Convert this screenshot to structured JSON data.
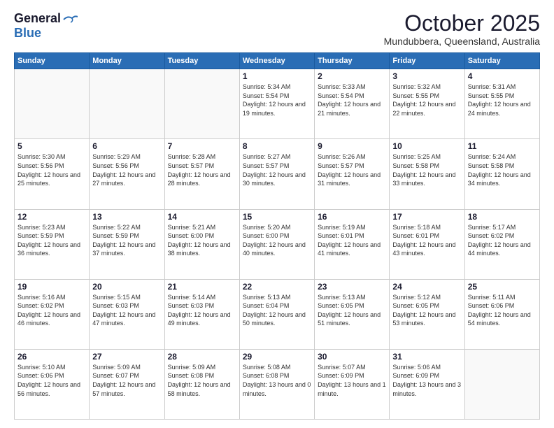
{
  "header": {
    "logo_general": "General",
    "logo_blue": "Blue",
    "month": "October 2025",
    "location": "Mundubbera, Queensland, Australia"
  },
  "days_of_week": [
    "Sunday",
    "Monday",
    "Tuesday",
    "Wednesday",
    "Thursday",
    "Friday",
    "Saturday"
  ],
  "weeks": [
    [
      {
        "day": "",
        "text": ""
      },
      {
        "day": "",
        "text": ""
      },
      {
        "day": "",
        "text": ""
      },
      {
        "day": "1",
        "text": "Sunrise: 5:34 AM\nSunset: 5:54 PM\nDaylight: 12 hours\nand 19 minutes."
      },
      {
        "day": "2",
        "text": "Sunrise: 5:33 AM\nSunset: 5:54 PM\nDaylight: 12 hours\nand 21 minutes."
      },
      {
        "day": "3",
        "text": "Sunrise: 5:32 AM\nSunset: 5:55 PM\nDaylight: 12 hours\nand 22 minutes."
      },
      {
        "day": "4",
        "text": "Sunrise: 5:31 AM\nSunset: 5:55 PM\nDaylight: 12 hours\nand 24 minutes."
      }
    ],
    [
      {
        "day": "5",
        "text": "Sunrise: 5:30 AM\nSunset: 5:56 PM\nDaylight: 12 hours\nand 25 minutes."
      },
      {
        "day": "6",
        "text": "Sunrise: 5:29 AM\nSunset: 5:56 PM\nDaylight: 12 hours\nand 27 minutes."
      },
      {
        "day": "7",
        "text": "Sunrise: 5:28 AM\nSunset: 5:57 PM\nDaylight: 12 hours\nand 28 minutes."
      },
      {
        "day": "8",
        "text": "Sunrise: 5:27 AM\nSunset: 5:57 PM\nDaylight: 12 hours\nand 30 minutes."
      },
      {
        "day": "9",
        "text": "Sunrise: 5:26 AM\nSunset: 5:57 PM\nDaylight: 12 hours\nand 31 minutes."
      },
      {
        "day": "10",
        "text": "Sunrise: 5:25 AM\nSunset: 5:58 PM\nDaylight: 12 hours\nand 33 minutes."
      },
      {
        "day": "11",
        "text": "Sunrise: 5:24 AM\nSunset: 5:58 PM\nDaylight: 12 hours\nand 34 minutes."
      }
    ],
    [
      {
        "day": "12",
        "text": "Sunrise: 5:23 AM\nSunset: 5:59 PM\nDaylight: 12 hours\nand 36 minutes."
      },
      {
        "day": "13",
        "text": "Sunrise: 5:22 AM\nSunset: 5:59 PM\nDaylight: 12 hours\nand 37 minutes."
      },
      {
        "day": "14",
        "text": "Sunrise: 5:21 AM\nSunset: 6:00 PM\nDaylight: 12 hours\nand 38 minutes."
      },
      {
        "day": "15",
        "text": "Sunrise: 5:20 AM\nSunset: 6:00 PM\nDaylight: 12 hours\nand 40 minutes."
      },
      {
        "day": "16",
        "text": "Sunrise: 5:19 AM\nSunset: 6:01 PM\nDaylight: 12 hours\nand 41 minutes."
      },
      {
        "day": "17",
        "text": "Sunrise: 5:18 AM\nSunset: 6:01 PM\nDaylight: 12 hours\nand 43 minutes."
      },
      {
        "day": "18",
        "text": "Sunrise: 5:17 AM\nSunset: 6:02 PM\nDaylight: 12 hours\nand 44 minutes."
      }
    ],
    [
      {
        "day": "19",
        "text": "Sunrise: 5:16 AM\nSunset: 6:02 PM\nDaylight: 12 hours\nand 46 minutes."
      },
      {
        "day": "20",
        "text": "Sunrise: 5:15 AM\nSunset: 6:03 PM\nDaylight: 12 hours\nand 47 minutes."
      },
      {
        "day": "21",
        "text": "Sunrise: 5:14 AM\nSunset: 6:03 PM\nDaylight: 12 hours\nand 49 minutes."
      },
      {
        "day": "22",
        "text": "Sunrise: 5:13 AM\nSunset: 6:04 PM\nDaylight: 12 hours\nand 50 minutes."
      },
      {
        "day": "23",
        "text": "Sunrise: 5:13 AM\nSunset: 6:05 PM\nDaylight: 12 hours\nand 51 minutes."
      },
      {
        "day": "24",
        "text": "Sunrise: 5:12 AM\nSunset: 6:05 PM\nDaylight: 12 hours\nand 53 minutes."
      },
      {
        "day": "25",
        "text": "Sunrise: 5:11 AM\nSunset: 6:06 PM\nDaylight: 12 hours\nand 54 minutes."
      }
    ],
    [
      {
        "day": "26",
        "text": "Sunrise: 5:10 AM\nSunset: 6:06 PM\nDaylight: 12 hours\nand 56 minutes."
      },
      {
        "day": "27",
        "text": "Sunrise: 5:09 AM\nSunset: 6:07 PM\nDaylight: 12 hours\nand 57 minutes."
      },
      {
        "day": "28",
        "text": "Sunrise: 5:09 AM\nSunset: 6:08 PM\nDaylight: 12 hours\nand 58 minutes."
      },
      {
        "day": "29",
        "text": "Sunrise: 5:08 AM\nSunset: 6:08 PM\nDaylight: 13 hours\nand 0 minutes."
      },
      {
        "day": "30",
        "text": "Sunrise: 5:07 AM\nSunset: 6:09 PM\nDaylight: 13 hours\nand 1 minute."
      },
      {
        "day": "31",
        "text": "Sunrise: 5:06 AM\nSunset: 6:09 PM\nDaylight: 13 hours\nand 3 minutes."
      },
      {
        "day": "",
        "text": ""
      }
    ]
  ]
}
